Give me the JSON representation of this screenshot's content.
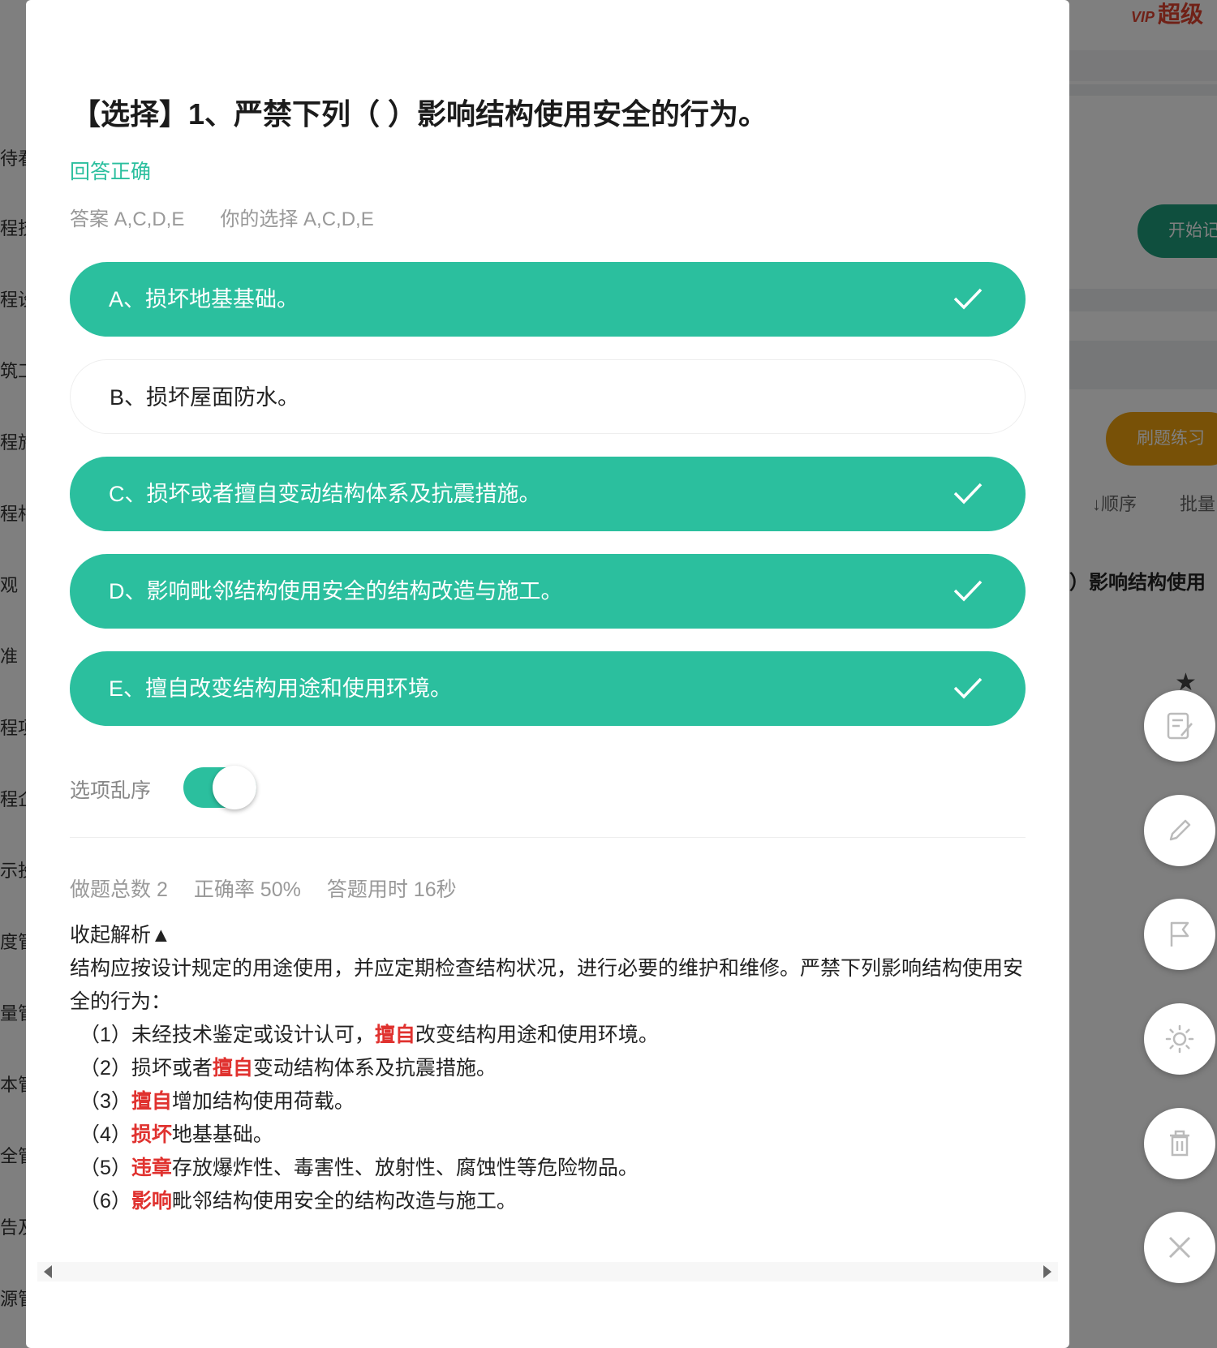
{
  "background": {
    "vip_tag": "VIP",
    "vip_text": "超级",
    "sidebar_items": [
      "待看",
      "程技",
      "程设",
      "筑工",
      "程施",
      "程相",
      "观",
      "准",
      "程项",
      "程企",
      "示投",
      "度管",
      "量管",
      "本管",
      "全管",
      "告及",
      "源管"
    ],
    "start_button": "开始记",
    "practice_button": "刷题练习",
    "sort_label": "↓顺序",
    "batch_label": "批量",
    "question_snippet": "）影响结构使用"
  },
  "modal": {
    "question_title": "【选择】1、严禁下列（ ）影响结构使用安全的行为。",
    "result_text": "回答正确",
    "answer_label": "答案 A,C,D,E",
    "your_choice_label": "你的选择 A,C,D,E",
    "options": [
      {
        "label": "A、损坏地基基础。",
        "selected": true
      },
      {
        "label": "B、损坏屋面防水。",
        "selected": false
      },
      {
        "label": "C、损坏或者擅自变动结构体系及抗震措施。",
        "selected": true
      },
      {
        "label": "D、影响毗邻结构使用安全的结构改造与施工。",
        "selected": true
      },
      {
        "label": "E、擅自改变结构用途和使用环境。",
        "selected": true
      }
    ],
    "shuffle_label": "选项乱序",
    "shuffle_on": true,
    "stats": {
      "total": "做题总数 2",
      "accuracy": "正确率 50%",
      "time": "答题用时 16秒"
    },
    "analysis": {
      "toggle_label": "收起解析▲",
      "intro": "结构应按设计规定的用途使用，并应定期检查结构状况，进行必要的维护和维修。严禁下列影响结构使用安全的行为：",
      "items": [
        {
          "prefix": "（1）未经技术鉴定或设计认可，",
          "highlight": "擅自",
          "suffix": "改变结构用途和使用环境。"
        },
        {
          "prefix": "（2）损坏或者",
          "highlight": "擅自",
          "suffix": "变动结构体系及抗震措施。"
        },
        {
          "prefix": "（3）",
          "highlight": "擅自",
          "suffix": "增加结构使用荷载。"
        },
        {
          "prefix": "（4）",
          "highlight": "损坏",
          "suffix": "地基基础。"
        },
        {
          "prefix": "（5）",
          "highlight": "违章",
          "suffix": "存放爆炸性、毒害性、放射性、腐蚀性等危险物品。"
        },
        {
          "prefix": "（6）",
          "highlight": "影响",
          "suffix": "毗邻结构使用安全的结构改造与施工。"
        }
      ]
    }
  },
  "side_actions": [
    "note-icon",
    "pencil-icon",
    "flag-icon",
    "brightness-icon",
    "trash-icon",
    "close-icon"
  ],
  "colors": {
    "primary": "#2bbf9e",
    "highlight": "#e0322f",
    "practice": "#f0a30f"
  }
}
